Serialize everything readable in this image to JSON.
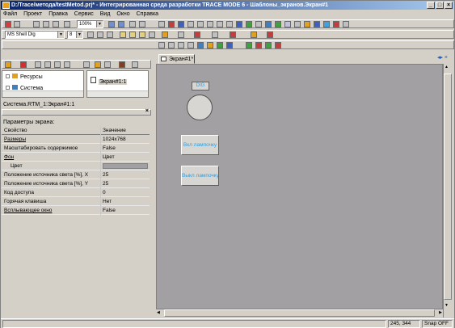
{
  "window": {
    "title": "D:/Trace/метода/testMetod.prj* - Интегрированная среда разработки TRACE MODE 6 - Шаблоны_экранов.Экран#1"
  },
  "menu": [
    "Файл",
    "Проект",
    "Правка",
    "Сервис",
    "Вид",
    "Окно",
    "Справка"
  ],
  "toolbar": {
    "zoom": "100%",
    "font_name": "MS Shell Dlg",
    "font_size": "8"
  },
  "tree": {
    "item1": "Ресурсы",
    "item2": "Система"
  },
  "tree2": {
    "item1": "Экран#1:1"
  },
  "breadcrumb": "Система.RTM_1:Экран#1:1",
  "props": {
    "header": "Параметры экрана:",
    "col_prop": "Свойство",
    "col_value": "Значение",
    "rows": [
      {
        "k": "Размеры",
        "v": "1024x768"
      },
      {
        "k": "Масштабировать содержимое",
        "v": "False"
      },
      {
        "k": "Фон",
        "v": "Цвет"
      },
      {
        "k": "Цвет",
        "v": ""
      },
      {
        "k": "Положение источника света [%], X",
        "v": "25"
      },
      {
        "k": "Положение источника света [%], Y",
        "v": "25"
      },
      {
        "k": "Код доступа",
        "v": "0"
      },
      {
        "k": "Горячая клавиша",
        "v": "Нет"
      },
      {
        "k": "Всплывающее окно",
        "v": "False"
      }
    ]
  },
  "tab": {
    "label": "Экран#1*"
  },
  "canvas": {
    "digit_label": "DIG",
    "btn_on": "Вкл лампочку",
    "btn_off": "Выкл лампочку"
  },
  "status": {
    "coords": "245, 344",
    "snap": "Snap OFF"
  },
  "colors": {
    "canvas_bg": "#a2a0a3",
    "widget_text": "#2aa0e0",
    "titlebar": "#0a246a"
  }
}
